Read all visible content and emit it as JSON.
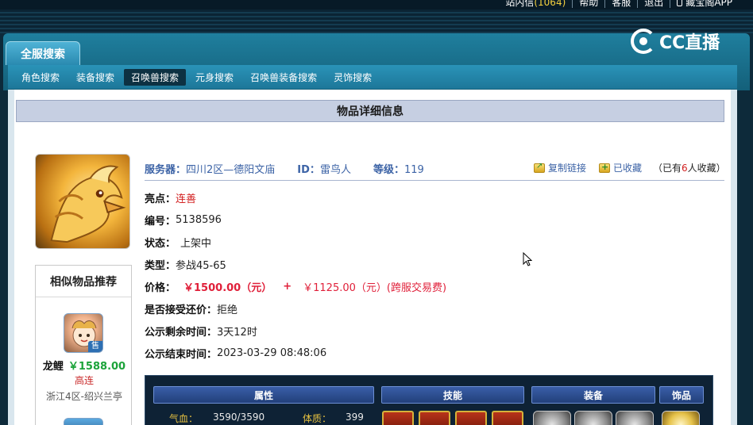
{
  "topbar": {
    "links": [
      {
        "label": "站内信",
        "count": "(1064)"
      },
      {
        "label": "帮助"
      },
      {
        "label": "客服"
      },
      {
        "label": "退出"
      },
      {
        "label": "藏宝阁APP"
      }
    ]
  },
  "header": {
    "search_tab": "全服搜索",
    "logo_text": "CC直播",
    "nav": [
      {
        "label": "角色搜索",
        "active": false
      },
      {
        "label": "装备搜索",
        "active": false
      },
      {
        "label": "召唤兽搜索",
        "active": true
      },
      {
        "label": "元身搜索",
        "active": false
      },
      {
        "label": "召唤兽装备搜索",
        "active": false
      },
      {
        "label": "灵饰搜索",
        "active": false
      }
    ]
  },
  "panel": {
    "title": "物品详细信息"
  },
  "info": {
    "server_label": "服务器：",
    "server_value": "四川2区—德阳文庙",
    "id_label": "ID：",
    "id_value": "雷鸟人",
    "level_label": "等级：",
    "level_value": "119",
    "copy_link": "复制链接",
    "favorited": "已收藏",
    "fav_prefix": "（已有",
    "fav_count": "6",
    "fav_suffix": "人收藏）"
  },
  "details": {
    "highlight_label": "亮点：",
    "highlight_value": "连善",
    "number_label": "编号：",
    "number_value": "5138596",
    "status_label": "状态：",
    "status_value": "上架中",
    "type_label": "类型：",
    "type_value": "参战45-65",
    "price_label": "价格：",
    "price_value": "￥1500.00（元）",
    "price_plus": "+",
    "price_fee": "￥1125.00（元）(跨服交易费)",
    "counter_label": "是否接受还价：",
    "counter_value": "拒绝",
    "remaining_label": "公示剩余时间：",
    "remaining_value": "3天12时",
    "end_label": "公示结束时间：",
    "end_value": "2023-03-29 08:48:06"
  },
  "related": {
    "title": "相似物品推荐",
    "badge": "售",
    "item": {
      "name": "龙鲤",
      "price": "￥1588.00",
      "tag": "高连",
      "server": "浙江4区-绍兴兰亭"
    }
  },
  "stats": {
    "headers": [
      "属性",
      "技能",
      "装备",
      "饰品"
    ],
    "hp_label": "气血：",
    "hp_value": "3590/3590",
    "con_label": "体质：",
    "con_value": "399"
  },
  "colors": {
    "header_blue": "#1f7f9e",
    "link_blue": "#3c63a6",
    "price_red": "#e0203a",
    "price_green": "#1ca33a"
  }
}
